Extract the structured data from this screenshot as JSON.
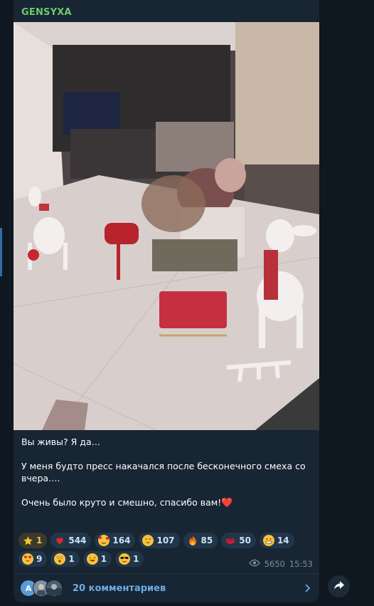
{
  "channel": {
    "name": "GENSYXA"
  },
  "message": {
    "lines": [
      "Вы живы? Я да…",
      "У меня будто пресс накачался после бесконечного смеха со вчера….",
      "Очень было круто и смешно, спасибо вам!"
    ],
    "heart": "❤️"
  },
  "reactions": {
    "row1": [
      {
        "icon": "star-icon",
        "count": "1"
      },
      {
        "icon": "red-heart-icon",
        "count": "544"
      },
      {
        "icon": "smiling-face-with-hearts-icon",
        "count": "164"
      },
      {
        "icon": "thinking-face-icon",
        "count": "107"
      },
      {
        "icon": "fire-icon",
        "count": "85"
      },
      {
        "icon": "kiss-mark-icon",
        "count": "50"
      },
      {
        "icon": "grimacing-face-icon",
        "count": "14"
      }
    ],
    "row2": [
      {
        "icon": "heart-eyes-icon",
        "count": "9"
      },
      {
        "icon": "screaming-face-icon",
        "count": "1"
      },
      {
        "icon": "rofl-face-icon",
        "count": "1"
      },
      {
        "icon": "sunglasses-face-icon",
        "count": "1"
      }
    ]
  },
  "meta": {
    "views": "5650",
    "time": "15:53"
  },
  "comments": {
    "label": "20 комментариев",
    "avatar_letter": "A"
  },
  "colors": {
    "channel_name": "#6bcb6b",
    "link": "#6aaee6",
    "bubble": "#182533",
    "background": "#0f1720"
  }
}
